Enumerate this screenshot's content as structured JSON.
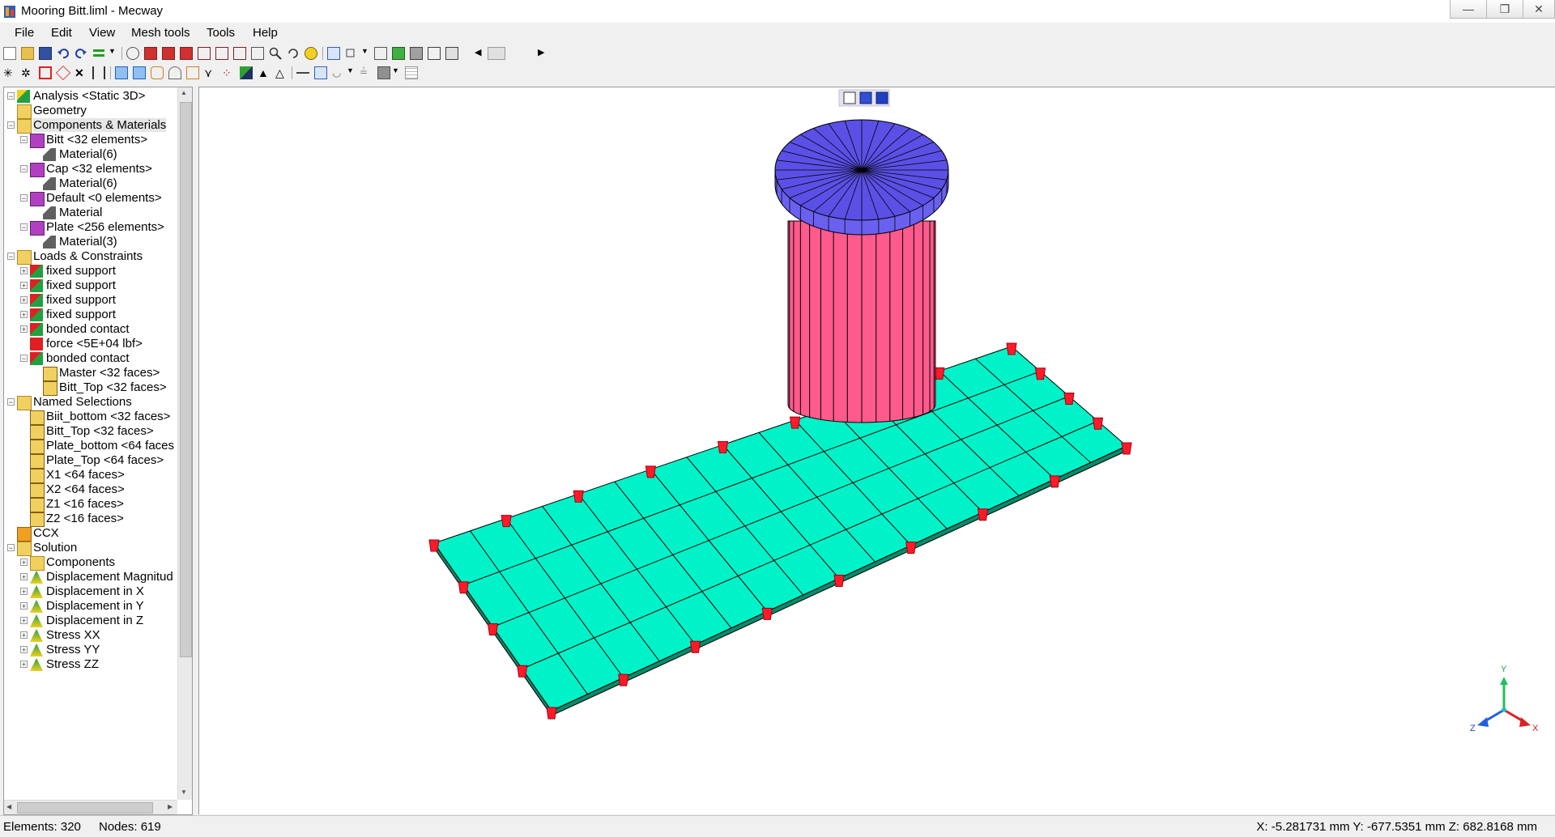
{
  "window": {
    "title": "Mooring Bitt.liml - Mecway",
    "min_glyph": "—",
    "max_glyph": "❐",
    "close_glyph": "✕"
  },
  "menu": [
    "File",
    "Edit",
    "View",
    "Mesh tools",
    "Tools",
    "Help"
  ],
  "tree": [
    {
      "label": "Analysis <Static 3D>",
      "icon": "analysis-icon"
    },
    {
      "label": "Geometry",
      "icon": "folder-icon"
    },
    {
      "label": "Components & Materials",
      "icon": "components-folder-icon"
    },
    {
      "label": "Bitt <32 elements>",
      "icon": "component-icon"
    },
    {
      "label": "Material(6)",
      "icon": "material-icon"
    },
    {
      "label": "Cap <32 elements>",
      "icon": "component-icon"
    },
    {
      "label": "Material(6)",
      "icon": "material-icon"
    },
    {
      "label": "Default <0 elements>",
      "icon": "component-icon"
    },
    {
      "label": "Material",
      "icon": "material-icon"
    },
    {
      "label": "Plate <256 elements>",
      "icon": "component-icon"
    },
    {
      "label": "Material(3)",
      "icon": "material-icon"
    },
    {
      "label": "Loads & Constraints",
      "icon": "loads-folder-icon"
    },
    {
      "label": "fixed support",
      "icon": "constraint-icon"
    },
    {
      "label": "fixed support",
      "icon": "constraint-icon"
    },
    {
      "label": "fixed support",
      "icon": "constraint-icon"
    },
    {
      "label": "fixed support",
      "icon": "constraint-icon"
    },
    {
      "label": "bonded contact",
      "icon": "constraint-icon"
    },
    {
      "label": "force <5E+04 lbf>",
      "icon": "force-icon"
    },
    {
      "label": "bonded contact",
      "icon": "constraint-icon"
    },
    {
      "label": "Master <32 faces>",
      "icon": "faces-icon"
    },
    {
      "label": "Bitt_Top <32 faces>",
      "icon": "faces-icon"
    },
    {
      "label": "Named Selections",
      "icon": "selection-folder-icon"
    },
    {
      "label": "Biit_bottom <32 faces>",
      "icon": "faces-icon"
    },
    {
      "label": "Bitt_Top <32 faces>",
      "icon": "faces-icon"
    },
    {
      "label": "Plate_bottom <64 faces",
      "icon": "faces-icon"
    },
    {
      "label": "Plate_Top <64 faces>",
      "icon": "faces-icon"
    },
    {
      "label": "X1 <64 faces>",
      "icon": "faces-icon"
    },
    {
      "label": "X2 <64 faces>",
      "icon": "faces-icon"
    },
    {
      "label": "Z1 <16 faces>",
      "icon": "faces-icon"
    },
    {
      "label": "Z2 <16 faces>",
      "icon": "faces-icon"
    },
    {
      "label": "CCX",
      "icon": "ccx-icon"
    },
    {
      "label": "Solution",
      "icon": "solution-icon"
    },
    {
      "label": "Components",
      "icon": "components-folder-icon"
    },
    {
      "label": "Displacement Magnitud",
      "icon": "result-icon"
    },
    {
      "label": "Displacement in X",
      "icon": "result-icon"
    },
    {
      "label": "Displacement in Y",
      "icon": "result-icon"
    },
    {
      "label": "Displacement in Z",
      "icon": "result-icon"
    },
    {
      "label": "Stress XX",
      "icon": "result-icon"
    },
    {
      "label": "Stress YY",
      "icon": "result-icon"
    },
    {
      "label": "Stress ZZ",
      "icon": "result-icon"
    }
  ],
  "axis_triad": {
    "y": "Y",
    "x": "X",
    "z": "Z"
  },
  "status": {
    "elements": "Elements:  320",
    "nodes": "Nodes: 619",
    "coords": "X: -5.281731 mm Y: -677.5351 mm Z: 682.8168 mm"
  },
  "colors": {
    "plate": "#00f2c8",
    "bitt": "#ff5a8c",
    "cap": "#5a50e6",
    "support": "#ff1a2a"
  }
}
